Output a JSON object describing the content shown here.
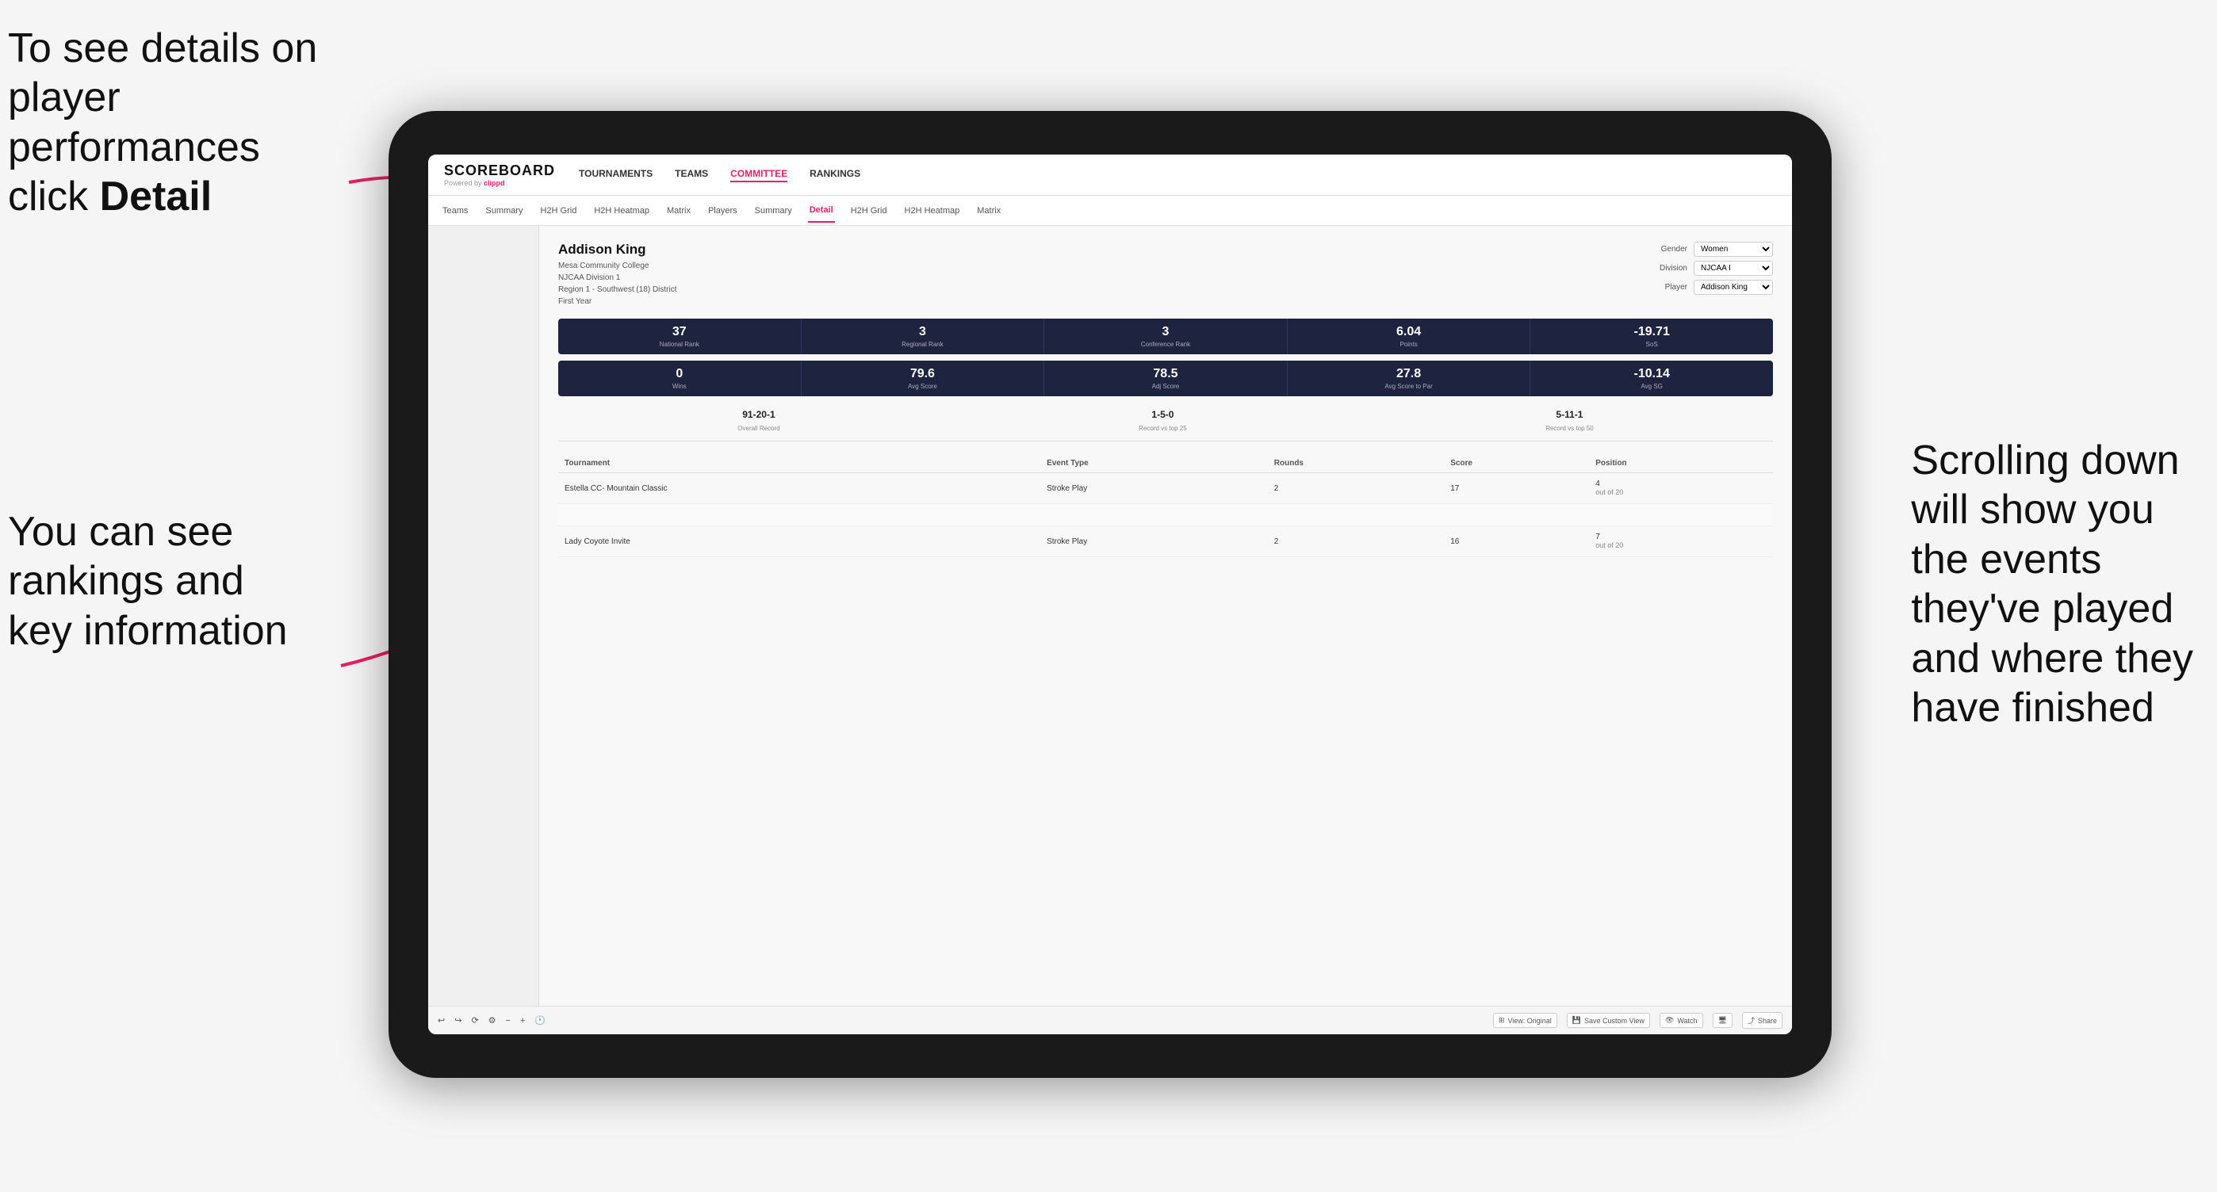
{
  "annotations": {
    "top_left": "To see details on player performances click ",
    "top_left_bold": "Detail",
    "bottom_left_line1": "You can see",
    "bottom_left_line2": "rankings and",
    "bottom_left_line3": "key information",
    "right_line1": "Scrolling down",
    "right_line2": "will show you",
    "right_line3": "the events",
    "right_line4": "they've played",
    "right_line5": "and where they",
    "right_line6": "have finished"
  },
  "nav": {
    "logo": "SCOREBOARD",
    "powered_by": "Powered by clippd",
    "main_items": [
      "TOURNAMENTS",
      "TEAMS",
      "COMMITTEE",
      "RANKINGS"
    ],
    "active_main": "COMMITTEE",
    "sub_items": [
      "Teams",
      "Summary",
      "H2H Grid",
      "H2H Heatmap",
      "Matrix",
      "Players",
      "Summary",
      "Detail",
      "H2H Grid",
      "H2H Heatmap",
      "Matrix"
    ],
    "active_sub": "Detail"
  },
  "player": {
    "name": "Addison King",
    "school": "Mesa Community College",
    "division": "NJCAA Division 1",
    "region": "Region 1 - Southwest (18) District",
    "year": "First Year",
    "gender_label": "Gender",
    "gender_value": "Women",
    "division_label": "Division",
    "division_value": "NJCAA I",
    "player_label": "Player",
    "player_value": "Addison King"
  },
  "stats_row1": [
    {
      "value": "37",
      "label": "National Rank"
    },
    {
      "value": "3",
      "label": "Regional Rank"
    },
    {
      "value": "3",
      "label": "Conference Rank"
    },
    {
      "value": "6.04",
      "label": "Points"
    },
    {
      "value": "-19.71",
      "label": "SoS"
    }
  ],
  "stats_row2": [
    {
      "value": "0",
      "label": "Wins"
    },
    {
      "value": "79.6",
      "label": "Avg Score"
    },
    {
      "value": "78.5",
      "label": "Adj Score"
    },
    {
      "value": "27.8",
      "label": "Avg Score to Par"
    },
    {
      "value": "-10.14",
      "label": "Avg SG"
    }
  ],
  "records": [
    {
      "value": "91-20-1",
      "label": "Overall Record"
    },
    {
      "value": "1-5-0",
      "label": "Record vs top 25"
    },
    {
      "value": "5-11-1",
      "label": "Record vs top 50"
    }
  ],
  "table": {
    "headers": [
      "Tournament",
      "Event Type",
      "Rounds",
      "Score",
      "Position"
    ],
    "rows": [
      {
        "tournament": "Estella CC- Mountain Classic",
        "event_type": "Stroke Play",
        "rounds": "2",
        "score": "17",
        "position": "4\nout of 20"
      },
      {
        "tournament": "",
        "event_type": "",
        "rounds": "",
        "score": "",
        "position": ""
      },
      {
        "tournament": "Lady Coyote Invite",
        "event_type": "Stroke Play",
        "rounds": "2",
        "score": "16",
        "position": "7\nout of 20"
      }
    ]
  },
  "toolbar": {
    "view_label": "View: Original",
    "save_label": "Save Custom View",
    "watch_label": "Watch",
    "share_label": "Share"
  }
}
